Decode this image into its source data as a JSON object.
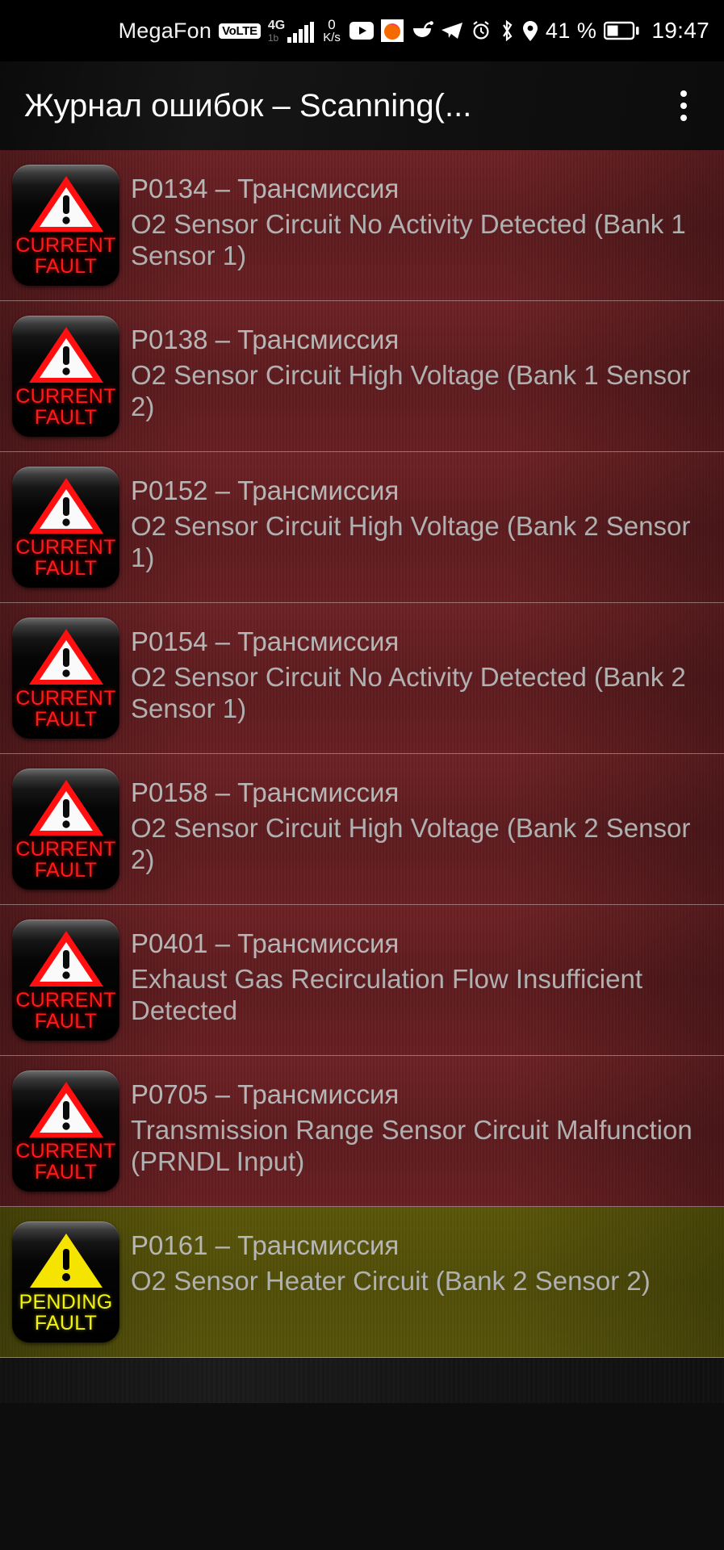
{
  "statusbar": {
    "carrier": "MegaFon",
    "volte_label": "VoLTE",
    "network_type": "4G",
    "network_sub": "1b",
    "data_speed_value": "0",
    "data_speed_unit": "K/s",
    "notification_icons": [
      "youtube-icon",
      "orange-app-icon",
      "drink-app-icon",
      "telegram-icon"
    ],
    "system_icons": [
      "alarm-icon",
      "bluetooth-icon",
      "location-icon"
    ],
    "battery_percent": "41 %",
    "time": "19:47"
  },
  "appbar": {
    "title": "Журнал ошибок – Scanning(...",
    "overflow_label": "overflow-menu"
  },
  "badges": {
    "current": {
      "line1": "CURRENT",
      "line2": "FAULT",
      "color": "#ff1a1a"
    },
    "pending": {
      "line1": "PENDING",
      "line2": "FAULT",
      "color": "#f3f313"
    }
  },
  "faults": [
    {
      "code": "P0134 – Трансмиссия",
      "desc": "O2 Sensor Circuit No Activity Detected (Bank 1 Sensor 1)",
      "status": "current"
    },
    {
      "code": "P0138 – Трансмиссия",
      "desc": "O2 Sensor Circuit High Voltage (Bank 1 Sensor 2)",
      "status": "current"
    },
    {
      "code": "P0152 – Трансмиссия",
      "desc": "O2 Sensor Circuit High Voltage (Bank 2 Sensor 1)",
      "status": "current"
    },
    {
      "code": "P0154 – Трансмиссия",
      "desc": "O2 Sensor Circuit No Activity Detected (Bank 2 Sensor 1)",
      "status": "current"
    },
    {
      "code": "P0158 – Трансмиссия",
      "desc": "O2 Sensor Circuit High Voltage (Bank 2 Sensor 2)",
      "status": "current"
    },
    {
      "code": "P0401 – Трансмиссия",
      "desc": "Exhaust Gas Recirculation Flow Insufficient Detected",
      "status": "current"
    },
    {
      "code": "P0705 – Трансмиссия",
      "desc": "Transmission Range Sensor Circuit Malfunction (PRNDL Input)",
      "status": "current"
    },
    {
      "code": "P0161 – Трансмиссия",
      "desc": "O2 Sensor Heater Circuit (Bank 2 Sensor 2)",
      "status": "pending"
    }
  ],
  "colors": {
    "current_row_bg": "#651e21",
    "pending_row_bg": "#55530a",
    "text": "#b0b0b0",
    "divider": "#d7d7d7"
  }
}
